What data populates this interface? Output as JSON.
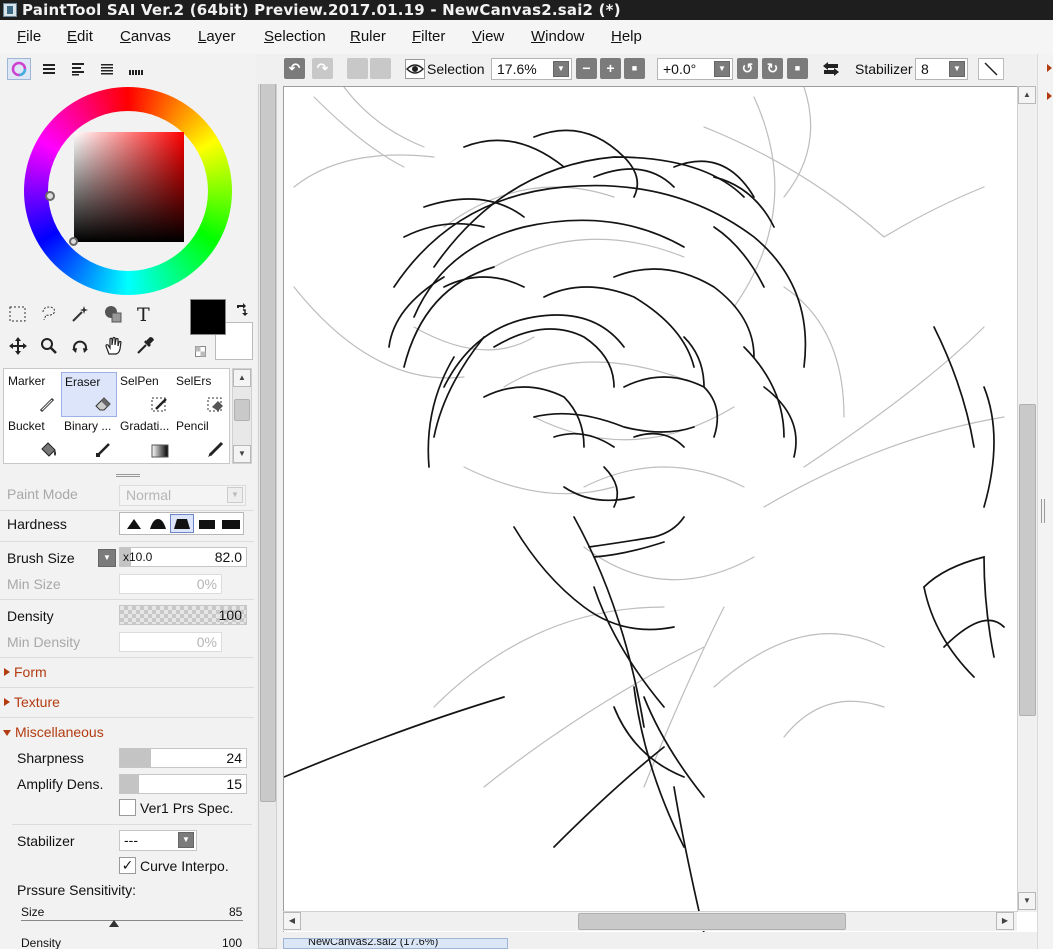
{
  "window": {
    "title": "PaintTool SAI Ver.2 (64bit) Preview.2017.01.19 - NewCanvas2.sai2 (*)"
  },
  "menu": [
    "File",
    "Edit",
    "Canvas",
    "Layer",
    "Selection",
    "Ruler",
    "Filter",
    "View",
    "Window",
    "Help"
  ],
  "color": {
    "foreground": "#000000",
    "background": "#ffffff",
    "hue_accent": "#ff0000"
  },
  "brushes": [
    {
      "label": "Marker",
      "icon": "marker-icon"
    },
    {
      "label": "Eraser",
      "icon": "eraser-icon",
      "selected": true
    },
    {
      "label": "SelPen",
      "icon": "selection-pen-icon"
    },
    {
      "label": "SelErs",
      "icon": "selection-eraser-icon"
    },
    {
      "label": "Bucket",
      "icon": "bucket-icon"
    },
    {
      "label": "Binary ...",
      "icon": "binary-pen-icon"
    },
    {
      "label": "Gradati...",
      "icon": "gradation-icon"
    },
    {
      "label": "Pencil",
      "icon": "pencil-icon"
    }
  ],
  "props": {
    "paint_mode_label": "Paint Mode",
    "paint_mode_value": "Normal",
    "hardness_label": "Hardness",
    "hardness_selected_index": 2,
    "brush_size_label": "Brush Size",
    "brush_size_multiplier": "x10.0",
    "brush_size_value": "82.0",
    "min_size_label": "Min Size",
    "min_size_value": "0%",
    "density_label": "Density",
    "density_value": "100",
    "min_density_label": "Min Density",
    "min_density_value": "0%",
    "form_label": "Form",
    "texture_label": "Texture",
    "misc_label": "Miscellaneous",
    "sharpness_label": "Sharpness",
    "sharpness_value": "24",
    "amplify_label": "Amplify Dens.",
    "amplify_value": "15",
    "ver1_label": "Ver1 Prs Spec.",
    "stabilizer_label": "Stabilizer",
    "stabilizer_value": "---",
    "curve_label": "Curve Interpo.",
    "pressure_label": "Prssure Sensitivity:",
    "size_label": "Size",
    "size_value": "85",
    "density2_label": "Density",
    "density2_value": "100"
  },
  "toolbar": {
    "selection_label": "Selection",
    "zoom": "17.6%",
    "rotation": "+0.0°",
    "stabilizer_label": "Stabilizer",
    "stabilizer_value": "8"
  },
  "tabs": {
    "canvas_tab": "NewCanvas2.sai2 (17.6%)"
  }
}
